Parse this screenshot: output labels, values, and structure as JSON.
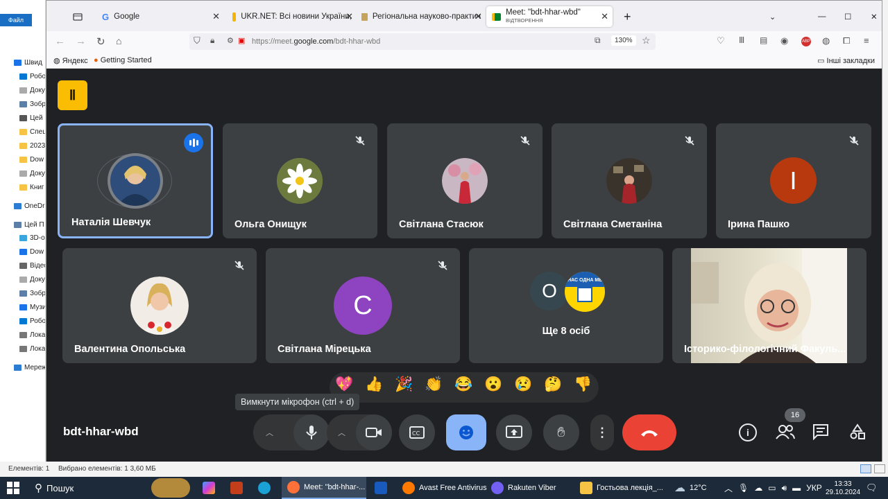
{
  "explorer": {
    "file_btn": "Файл",
    "items": [
      "Швид",
      "Робо",
      "Доку",
      "Зобр",
      "Цей",
      "Спец",
      "2023",
      "Dow",
      "Доку",
      "Книг",
      "OneDr",
      "Цей П",
      "3D-о",
      "Dow",
      "Відео",
      "Доку",
      "Зобр",
      "Музи",
      "Робо",
      "Лока",
      "Лока",
      "Мереж"
    ],
    "status_count": "Елементів: 1",
    "status_selected": "Вибрано елементів: 1  3,60 МБ"
  },
  "browser": {
    "tabs": [
      {
        "label": "Google",
        "icon": "google-icon"
      },
      {
        "label": "UKR.NET: Всі новини України,",
        "icon": "ukrnet-icon"
      },
      {
        "label": "Регіональна науково-практич",
        "icon": "page-icon"
      },
      {
        "label": "Meet: \"bdt-hhar-wbd\"",
        "sub": "ВІДТВОРЕННЯ",
        "icon": "meet-icon"
      }
    ],
    "new_tab": "+",
    "url_prefix": "https://meet.",
    "url_domain": "google.com",
    "url_path": "/bdt-hhar-wbd",
    "zoom": "130%",
    "bookmarks": [
      "Яндекс",
      "Getting Started"
    ],
    "other_bookmarks": "Інші закладки"
  },
  "meet": {
    "participants": [
      {
        "name": "Наталія Шевчук",
        "speaking": true
      },
      {
        "name": "Ольга Онищук",
        "muted": true
      },
      {
        "name": "Світлана Стасюк",
        "muted": true
      },
      {
        "name": "Світлана Сметаніна",
        "muted": true
      },
      {
        "name": "Ірина Пашко",
        "initial": "І",
        "muted": true
      },
      {
        "name": "Валентина Опольська",
        "muted": true
      },
      {
        "name": "Світлана Мірецька",
        "initial": "С",
        "muted": true
      },
      {
        "name": "Ще 8 осіб",
        "initial": "О"
      },
      {
        "name": "Історико-філологічний Факуль..."
      }
    ],
    "other_avatar_text": "НАС ОДНА МЕ",
    "reactions": [
      "💖",
      "👍",
      "🎉",
      "👏",
      "😂",
      "😮",
      "😢",
      "🤔",
      "👎"
    ],
    "tooltip": "Вимкнути мікрофон (ctrl + d)",
    "meeting_code": "bdt-hhar-wbd",
    "people_count": "16",
    "colors": {
      "bg": "#202124",
      "tile": "#3c4043",
      "blue": "#8ab4f8",
      "end": "#ea4335",
      "irina": "#b9390f",
      "svitlana": "#8e44c0"
    }
  },
  "taskbar": {
    "search": "Пошук",
    "apps": [
      "Meet: \"bdt-hhar-...",
      "Avast Free Antivirus",
      "Rakuten Viber",
      "Гостьова лекція_..."
    ],
    "weather": "12°C",
    "lang": "УКР",
    "time": "13:33",
    "date": "29.10.2024"
  }
}
